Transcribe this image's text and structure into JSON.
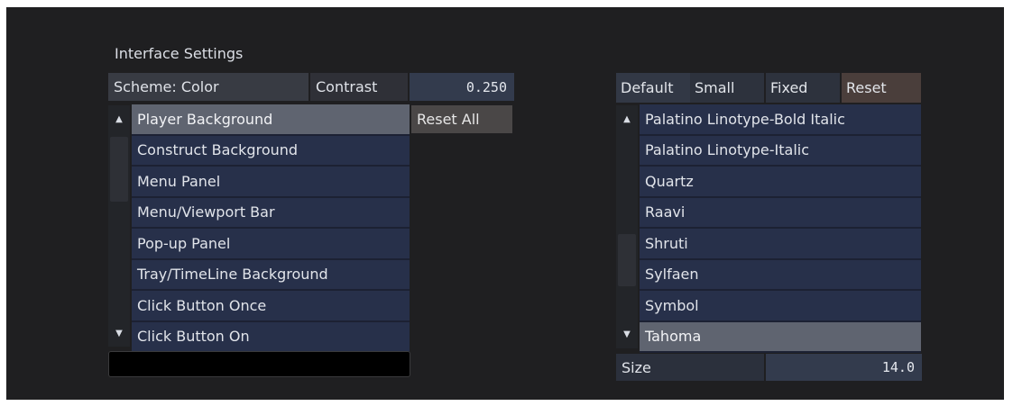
{
  "panel": {
    "title": "Interface Settings"
  },
  "left": {
    "scheme_label": "Scheme: Color",
    "contrast_label": "Contrast",
    "contrast_value": "0.250",
    "reset_all_label": "Reset All",
    "items": [
      "Player Background",
      "Construct Background",
      "Menu Panel",
      "Menu/Viewport Bar",
      "Pop-up Panel",
      "Tray/TimeLine Background",
      "Click Button Once",
      "Click Button On"
    ],
    "selected_index": 0,
    "text_field_value": ""
  },
  "right": {
    "tabs": [
      "Default",
      "Small",
      "Fixed",
      "Reset"
    ],
    "fonts": [
      "Palatino Linotype-Bold Italic",
      "Palatino Linotype-Italic",
      "Quartz",
      "Raavi",
      "Shruti",
      "Sylfaen",
      "Symbol",
      "Tahoma"
    ],
    "selected_index": 7,
    "size_label": "Size",
    "size_value": "14.0"
  },
  "icons": {
    "up": "▲",
    "down": "▼"
  },
  "colors": {
    "row": "#27304a",
    "selected_row": "#5f6470",
    "value_field": "#333b4d",
    "reset_tab": "#4a3e3b"
  }
}
